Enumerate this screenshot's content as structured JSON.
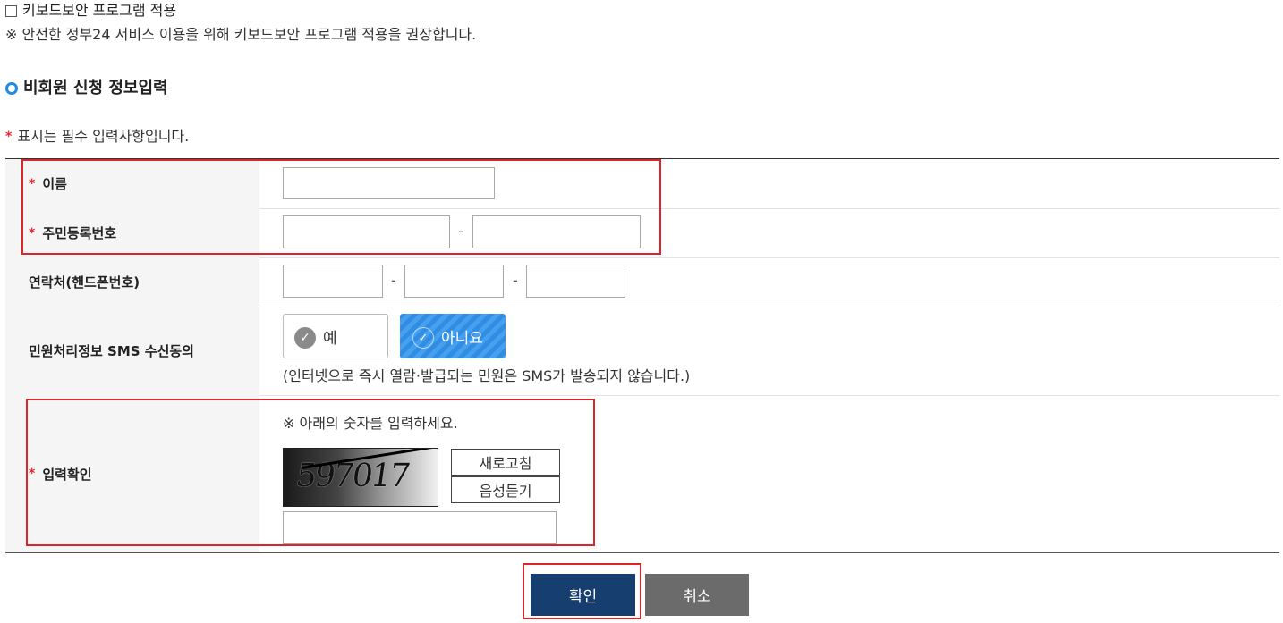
{
  "keyboard_security": {
    "checkbox_label": "키보드보안 프로그램 적용",
    "checked": false,
    "note": "※ 안전한 정부24 서비스 이용을 위해 키보드보안 프로그램 적용을 권장합니다."
  },
  "section": {
    "title": "비회원 신청 정보입력",
    "required_note": "표시는 필수 입력사항입니다.",
    "required_mark": "*"
  },
  "form": {
    "name": {
      "label": "이름",
      "value": ""
    },
    "rrn": {
      "label": "주민등록번호",
      "value_front": "",
      "value_back": "",
      "separator": "-"
    },
    "phone": {
      "label": "연락처(핸드폰번호)",
      "part1": "",
      "part2": "",
      "part3": "",
      "separator": "-"
    },
    "sms": {
      "label": "민원처리정보 SMS 수신동의",
      "yes_label": "예",
      "no_label": "아니요",
      "selected": "아니요",
      "note": "(인터넷으로 즉시 열람·발급되는 민원은 SMS가 발송되지 않습니다.)"
    },
    "captcha": {
      "label": "입력확인",
      "instruction": "※ 아래의 숫자를 입력하세요.",
      "image_text": "597017",
      "refresh_label": "새로고침",
      "audio_label": "음성듣기",
      "value": ""
    }
  },
  "actions": {
    "confirm_label": "확인",
    "cancel_label": "취소"
  },
  "colors": {
    "required": "#e3262e",
    "accent_blue": "#2f8de4",
    "confirm_bg": "#163f70",
    "cancel_bg": "#6b6b6b",
    "highlight": "#d9252b"
  },
  "icons": {
    "section_bullet": "circle-bullet-icon",
    "check": "check-icon"
  }
}
